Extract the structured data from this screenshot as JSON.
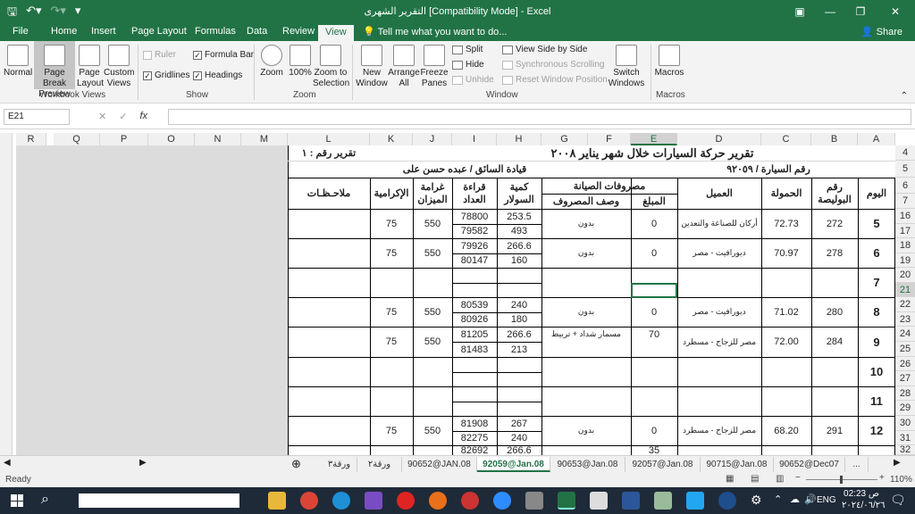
{
  "window": {
    "title": "التقرير الشهرى  [Compatibility Mode] - Excel"
  },
  "tabs": [
    "File",
    "Home",
    "Insert",
    "Page Layout",
    "Formulas",
    "Data",
    "Review",
    "View"
  ],
  "tellme": "Tell me what you want to do...",
  "share": "Share",
  "ribbon": {
    "normal": "Normal",
    "page_break": "Page Break Preview",
    "page_layout": "Page Layout",
    "custom_views": "Custom Views",
    "ruler": "Ruler",
    "formula_bar": "Formula Bar",
    "gridlines": "Gridlines",
    "headings": "Headings",
    "zoom": "Zoom",
    "zoom100": "100%",
    "zoom_sel": "Zoom to Selection",
    "new_window": "New Window",
    "arrange_all": "Arrange All",
    "freeze": "Freeze Panes",
    "split": "Split",
    "hide": "Hide",
    "unhide": "Unhide",
    "side_by_side": "View Side by Side",
    "sync_scroll": "Synchronous Scrolling",
    "reset_pos": "Reset Window Position",
    "switch": "Switch Windows",
    "macros": "Macros",
    "groups": {
      "workbook_views": "Workbook Views",
      "show": "Show",
      "zoom": "Zoom",
      "window": "Window",
      "macros": "Macros"
    }
  },
  "namebox": "E21",
  "fx": "fx",
  "columns": [
    "R",
    "Q",
    "P",
    "O",
    "N",
    "M",
    "L",
    "K",
    "J",
    "I",
    "H",
    "G",
    "F",
    "E",
    "D",
    "C",
    "B",
    "A"
  ],
  "rows": [
    "4",
    "5",
    "6",
    "7",
    "16",
    "17",
    "18",
    "19",
    "20",
    "21",
    "22",
    "23",
    "24",
    "25",
    "26",
    "27",
    "28",
    "29",
    "30",
    "31",
    "32"
  ],
  "report": {
    "title": "تقرير حركة السيارات خلال شهر يناير ٢٠٠٨",
    "report_no": "تقرير رقم : ١",
    "car_no": "رقم السيارة /  ٩٢٠٥٩",
    "driver": "قيادة السائق / عبده حسن على",
    "h_day": "اليوم",
    "h_policy": "رقم البوليصة",
    "h_load": "الحمولة",
    "h_client": "العميل",
    "h_maint": "مصروفات الصيانة",
    "h_amount": "المبلغ",
    "h_desc": "وصف المصروف",
    "h_diesel": "كمية السولار",
    "h_meter": "قراءة العداد",
    "h_scale": "غرامة الميزان",
    "h_tip": "الإكرامية",
    "h_notes": "ملاحـظـات"
  },
  "entries": [
    {
      "day": "5",
      "policy": "272",
      "load": "72.73",
      "client": "أركان للصناعة والتعدين",
      "amount": "0",
      "desc": "بدون",
      "d1": "253.5",
      "d2": "493",
      "m1": "78800",
      "m2": "79582",
      "scale": "550",
      "tip": "75"
    },
    {
      "day": "6",
      "policy": "278",
      "load": "70.97",
      "client": "ديورافيت - مصر",
      "amount": "0",
      "desc": "بدون",
      "d1": "266.6",
      "d2": "160",
      "m1": "79926",
      "m2": "80147",
      "scale": "550",
      "tip": "75"
    },
    {
      "day": "7",
      "policy": "",
      "load": "",
      "client": "",
      "amount": "",
      "desc": "",
      "d1": "",
      "d2": "",
      "m1": "",
      "m2": "",
      "scale": "",
      "tip": ""
    },
    {
      "day": "8",
      "policy": "280",
      "load": "71.02",
      "client": "ديورافيت - مصر",
      "amount": "0",
      "desc": "بدون",
      "d1": "240",
      "d2": "180",
      "m1": "80539",
      "m2": "80926",
      "scale": "550",
      "tip": "75"
    },
    {
      "day": "9",
      "policy": "284",
      "load": "72.00",
      "client": "مصر للزجاج - مسطرد",
      "amount": "70",
      "desc": "مسمار شداد + تربيط",
      "d1": "266.6",
      "d2": "213",
      "m1": "81205",
      "m2": "81483",
      "scale": "550",
      "tip": "75"
    },
    {
      "day": "10",
      "policy": "",
      "load": "",
      "client": "",
      "amount": "",
      "desc": "",
      "d1": "",
      "d2": "",
      "m1": "",
      "m2": "",
      "scale": "",
      "tip": ""
    },
    {
      "day": "11",
      "policy": "",
      "load": "",
      "client": "",
      "amount": "",
      "desc": "",
      "d1": "",
      "d2": "",
      "m1": "",
      "m2": "",
      "scale": "",
      "tip": ""
    },
    {
      "day": "12",
      "policy": "291",
      "load": "68.20",
      "client": "مصر للزجاج - مسطرد",
      "amount": "0",
      "desc": "بدون",
      "d1": "267",
      "d2": "240",
      "m1": "81908",
      "m2": "82275",
      "scale": "550",
      "tip": "75"
    }
  ],
  "partial": {
    "amount": "35",
    "d1": "266.6",
    "m1": "82692"
  },
  "sheets": [
    "ورقة٣",
    "ورقة٢",
    "90652@JAN.08",
    "92059@Jan.08",
    "90653@Jan.08",
    "92057@Jan.08",
    "90715@Jan.08",
    "90652@Dec07",
    "..."
  ],
  "status": {
    "ready": "Ready",
    "zoom": "110%"
  },
  "taskbar": {
    "time": "02:23 ص",
    "date": "٢٠٢٤/٠٦/٢٦",
    "lang": "ENG"
  }
}
